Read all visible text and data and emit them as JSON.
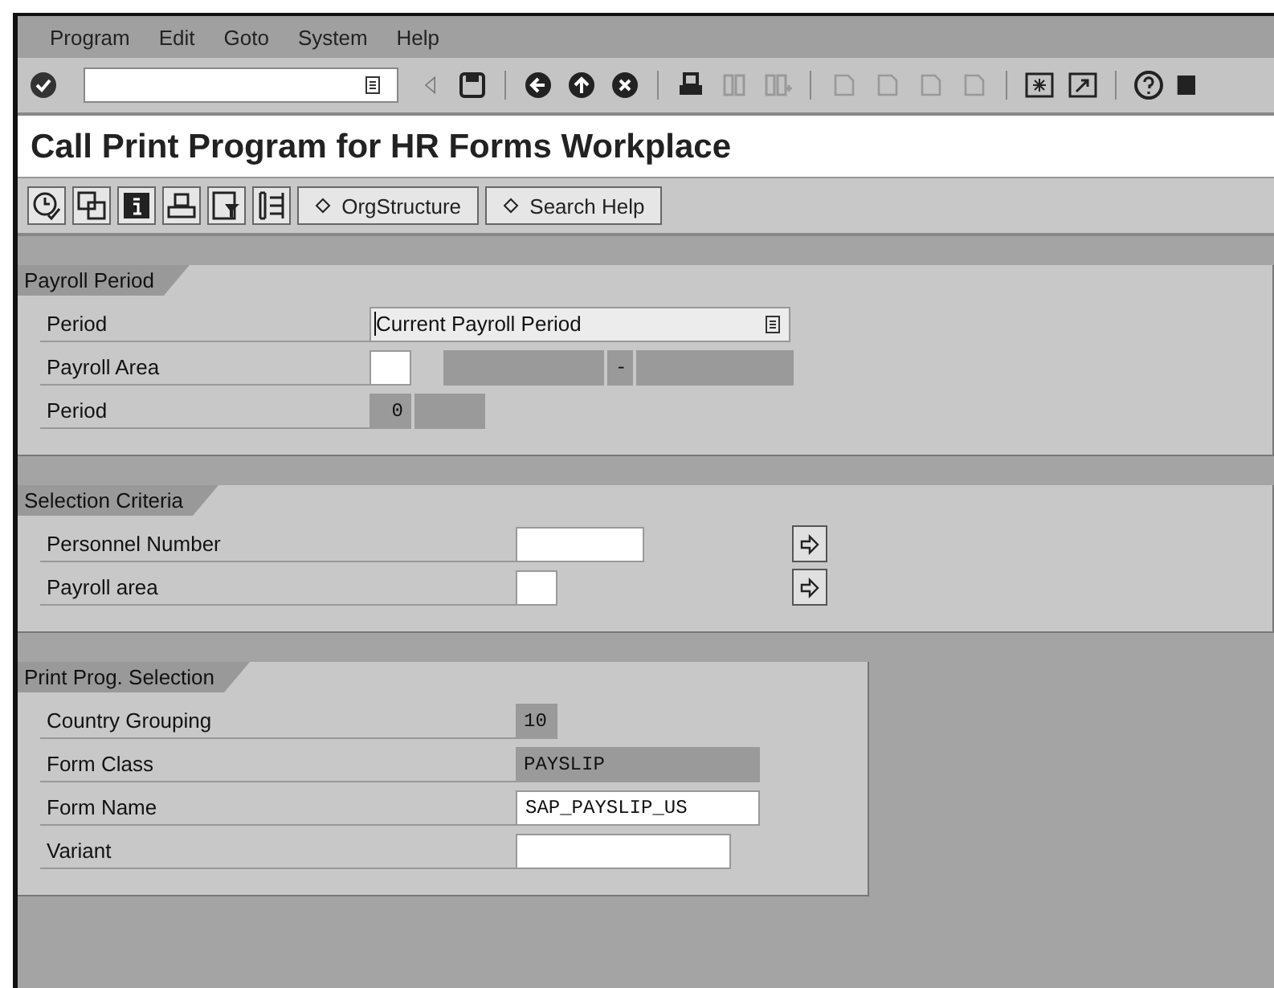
{
  "menu": [
    "Program",
    "Edit",
    "Goto",
    "System",
    "Help"
  ],
  "title": "Call Print Program for HR Forms Workplace",
  "app_toolbar": {
    "buttons": [
      "OrgStructure",
      "Search Help"
    ]
  },
  "groups": [
    {
      "title": "Payroll Period",
      "rows": [
        {
          "label": "Period",
          "fields": [
            {
              "kind": "dropdown",
              "value": "Current Payroll Period"
            }
          ]
        },
        {
          "label": "Payroll Area",
          "fields": [
            {
              "kind": "input"
            },
            {
              "kind": "display"
            },
            {
              "kind": "display",
              "value": "-"
            },
            {
              "kind": "display"
            }
          ]
        },
        {
          "label": "Period",
          "fields": [
            {
              "kind": "display",
              "value": "0"
            },
            {
              "kind": "display"
            }
          ]
        }
      ]
    },
    {
      "title": "Selection Criteria",
      "rows": [
        {
          "label": "Personnel Number",
          "fields": [
            {
              "kind": "input"
            }
          ],
          "multiselect": true
        },
        {
          "label": "Payroll area",
          "fields": [
            {
              "kind": "input"
            }
          ],
          "multiselect": true
        }
      ]
    },
    {
      "title": "Print Prog. Selection",
      "rows": [
        {
          "label": "Country Grouping",
          "fields": [
            {
              "kind": "display",
              "value": "10"
            }
          ]
        },
        {
          "label": "Form Class",
          "fields": [
            {
              "kind": "display",
              "value": "PAYSLIP"
            }
          ]
        },
        {
          "label": "Form Name",
          "fields": [
            {
              "kind": "input",
              "value": "SAP_PAYSLIP_US"
            }
          ]
        },
        {
          "label": "Variant",
          "fields": [
            {
              "kind": "input"
            }
          ]
        }
      ]
    }
  ]
}
